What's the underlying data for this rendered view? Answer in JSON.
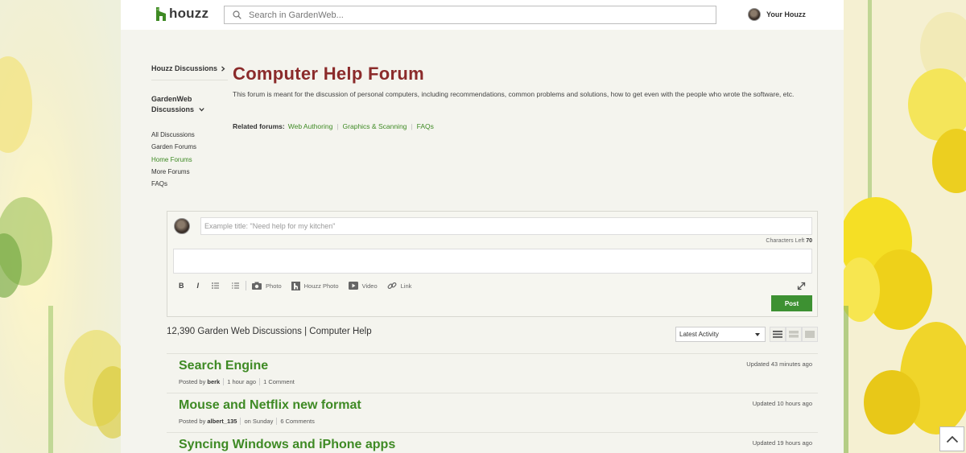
{
  "header": {
    "logo_text": "houzz",
    "search_placeholder": "Search in GardenWeb...",
    "user_label": "Your Houzz"
  },
  "sidebar": {
    "top_link": "Houzz Discussions",
    "section_title": "GardenWeb Discussions",
    "items": [
      {
        "label": "All Discussions",
        "active": false
      },
      {
        "label": "Garden Forums",
        "active": false
      },
      {
        "label": "Home Forums",
        "active": true
      },
      {
        "label": "More Forums",
        "active": false
      },
      {
        "label": "FAQs",
        "active": false
      }
    ]
  },
  "forum": {
    "title": "Computer Help Forum",
    "description": "This forum is meant for the discussion of personal computers, including recommendations, common problems and solutions, how to get even with the people who wrote the software, etc.",
    "related_label": "Related forums:",
    "related": [
      "Web Authoring",
      "Graphics & Scanning",
      "FAQs"
    ]
  },
  "composer": {
    "title_placeholder": "Example title: \"Need help for my kitchen\"",
    "chars_left_label": "Characters Left",
    "chars_left_value": "70",
    "toolbar": {
      "bold": "B",
      "italic": "I",
      "photo": "Photo",
      "houzz_photo": "Houzz Photo",
      "video": "Video",
      "link": "Link"
    },
    "post_label": "Post"
  },
  "listing": {
    "count_text": "12,390 Garden Web Discussions | Computer Help",
    "sort_value": "Latest Activity"
  },
  "discussions": [
    {
      "title": "Search Engine",
      "posted_by_label": "Posted by",
      "author": "berk",
      "time": "1 hour ago",
      "comments": "1 Comment",
      "updated": "Updated 43 minutes ago"
    },
    {
      "title": "Mouse and Netflix new format",
      "posted_by_label": "Posted by",
      "author": "albert_135",
      "time": "on Sunday",
      "comments": "6 Comments",
      "updated": "Updated 10 hours ago"
    },
    {
      "title": "Syncing Windows and iPhone apps",
      "updated": "Updated 19 hours ago"
    }
  ],
  "colors": {
    "brand_green": "#3e8a24",
    "title_red": "#8b2b2b",
    "post_button": "#3d9132"
  }
}
